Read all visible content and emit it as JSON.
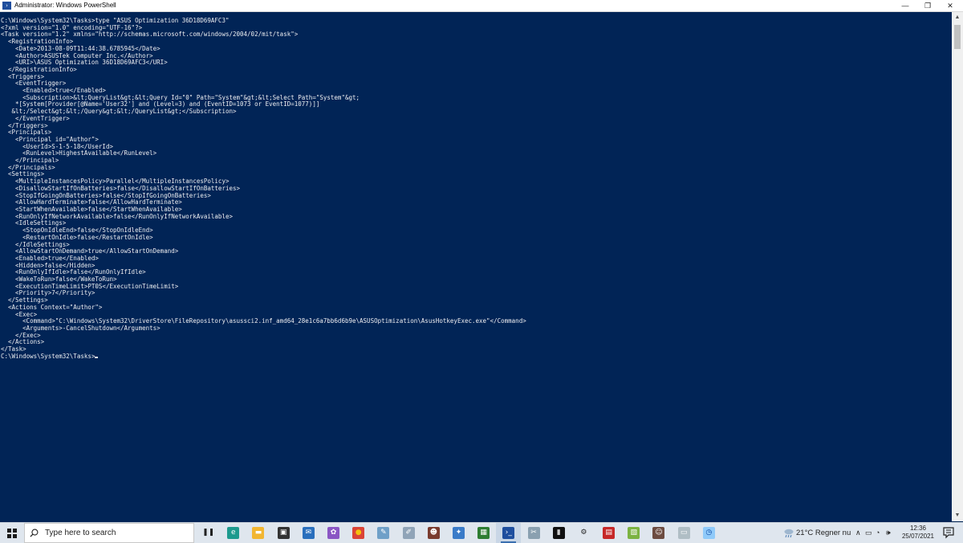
{
  "window": {
    "title": "Administrator: Windows PowerShell",
    "minimize_glyph": "—",
    "maximize_glyph": "❐",
    "close_glyph": "✕"
  },
  "console": {
    "lines": [
      "C:\\Windows\\System32\\Tasks>type \"ASUS Optimization 36D18D69AFC3\"",
      "<?xml version=\"1.0\" encoding=\"UTF-16\"?>",
      "<Task version=\"1.2\" xmlns=\"http://schemas.microsoft.com/windows/2004/02/mit/task\">",
      "  <RegistrationInfo>",
      "    <Date>2013-08-09T11:44:38.6785945</Date>",
      "    <Author>ASUSTek Computer Inc.</Author>",
      "    <URI>\\ASUS Optimization 36D18D69AFC3</URI>",
      "  </RegistrationInfo>",
      "  <Triggers>",
      "    <EventTrigger>",
      "      <Enabled>true</Enabled>",
      "      <Subscription>&lt;QueryList&gt;&lt;Query Id=\"0\" Path=\"System\"&gt;&lt;Select Path=\"System\"&gt;",
      "    *[System[Provider[@Name='User32'] and (Level=3) and (EventID=1073 or EventID=1077)]]",
      "   &lt;/Select&gt;&lt;/Query&gt;&lt;/QueryList&gt;</Subscription>",
      "    </EventTrigger>",
      "  </Triggers>",
      "  <Principals>",
      "    <Principal id=\"Author\">",
      "      <UserId>S-1-5-18</UserId>",
      "      <RunLevel>HighestAvailable</RunLevel>",
      "    </Principal>",
      "  </Principals>",
      "  <Settings>",
      "    <MultipleInstancesPolicy>Parallel</MultipleInstancesPolicy>",
      "    <DisallowStartIfOnBatteries>false</DisallowStartIfOnBatteries>",
      "    <StopIfGoingOnBatteries>false</StopIfGoingOnBatteries>",
      "    <AllowHardTerminate>false</AllowHardTerminate>",
      "    <StartWhenAvailable>false</StartWhenAvailable>",
      "    <RunOnlyIfNetworkAvailable>false</RunOnlyIfNetworkAvailable>",
      "    <IdleSettings>",
      "      <StopOnIdleEnd>false</StopOnIdleEnd>",
      "      <RestartOnIdle>false</RestartOnIdle>",
      "    </IdleSettings>",
      "    <AllowStartOnDemand>true</AllowStartOnDemand>",
      "    <Enabled>true</Enabled>",
      "    <Hidden>false</Hidden>",
      "    <RunOnlyIfIdle>false</RunOnlyIfIdle>",
      "    <WakeToRun>false</WakeToRun>",
      "    <ExecutionTimeLimit>PT0S</ExecutionTimeLimit>",
      "    <Priority>7</Priority>",
      "  </Settings>",
      "  <Actions Context=\"Author\">",
      "    <Exec>",
      "      <Command>\"C:\\Windows\\System32\\DriverStore\\FileRepository\\asussci2.inf_amd64_28e1c6a7bb6d6b9e\\ASUSOptimization\\AsusHotkeyExec.exe\"</Command>",
      "      <Arguments>-CancelShutdown</Arguments>",
      "    </Exec>",
      "  </Actions>",
      "</Task>"
    ],
    "prompt": "C:\\Windows\\System32\\Tasks>",
    "background_color": "#012456",
    "text_color": "#eeedf0"
  },
  "taskbar": {
    "search_placeholder": "Type here to search",
    "apps": [
      {
        "name": "task-view",
        "glyph": "❚❚",
        "bg": "#dfe6ee",
        "fg": "#222222"
      },
      {
        "name": "edge",
        "glyph": "e",
        "bg": "#1d9a8e",
        "fg": "#ffffff"
      },
      {
        "name": "file-explorer",
        "glyph": "▬",
        "bg": "#f2b632",
        "fg": "#ffffff"
      },
      {
        "name": "store",
        "glyph": "▣",
        "bg": "#333333",
        "fg": "#ffffff"
      },
      {
        "name": "mail",
        "glyph": "✉",
        "bg": "#2a6fbd",
        "fg": "#ffffff"
      },
      {
        "name": "paint-app",
        "glyph": "✿",
        "bg": "#8a56c4",
        "fg": "#ffffff"
      },
      {
        "name": "chrome",
        "glyph": "●",
        "bg": "#db4437",
        "fg": "#f4c20d"
      },
      {
        "name": "notepad-app",
        "glyph": "✎",
        "bg": "#6fa0c8",
        "fg": "#ffffff"
      },
      {
        "name": "editor-app",
        "glyph": "✐",
        "bg": "#90a4b8",
        "fg": "#ffffff"
      },
      {
        "name": "avatar-app",
        "glyph": "☻",
        "bg": "#7a3b2e",
        "fg": "#ffffff"
      },
      {
        "name": "utility-app",
        "glyph": "✦",
        "bg": "#3a7bc8",
        "fg": "#ffffff"
      },
      {
        "name": "task-manager",
        "glyph": "▦",
        "bg": "#2e7d32",
        "fg": "#ffffff"
      },
      {
        "name": "powershell",
        "glyph": "›_",
        "bg": "#1e4e9e",
        "fg": "#ffffff"
      },
      {
        "name": "snipping-app",
        "glyph": "✂",
        "bg": "#8aa0b0",
        "fg": "#ffffff"
      },
      {
        "name": "terminal",
        "glyph": "▮",
        "bg": "#111111",
        "fg": "#cccccc"
      },
      {
        "name": "settings",
        "glyph": "⚙",
        "bg": "#dfe6ee",
        "fg": "#222222"
      },
      {
        "name": "photos-app",
        "glyph": "▤",
        "bg": "#c62828",
        "fg": "#ffffff"
      },
      {
        "name": "sheet-app",
        "glyph": "▧",
        "bg": "#7cb342",
        "fg": "#ffffff"
      },
      {
        "name": "person-app",
        "glyph": "☺",
        "bg": "#6d4c41",
        "fg": "#ffffff"
      },
      {
        "name": "monitor-app",
        "glyph": "▭",
        "bg": "#b0bec5",
        "fg": "#ffffff"
      },
      {
        "name": "clock-app",
        "glyph": "◷",
        "bg": "#90caf9",
        "fg": "#0d47a1"
      }
    ],
    "weather": "21°C  Regner nu",
    "tray_chevron": "∧",
    "battery_glyph": "▭",
    "network_glyph": "◔",
    "volume_glyph": "🕪",
    "time": "12:36",
    "date": "25/07/2021"
  }
}
